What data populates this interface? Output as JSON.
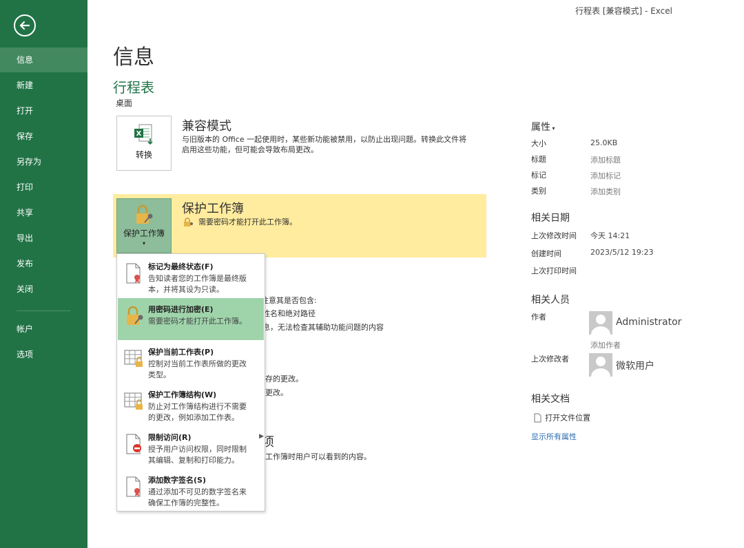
{
  "window_title": "行程表  [兼容模式] - Excel",
  "sidebar": {
    "items": [
      {
        "label": "信息",
        "active": true
      },
      {
        "label": "新建"
      },
      {
        "label": "打开"
      },
      {
        "label": "保存"
      },
      {
        "label": "另存为"
      },
      {
        "label": "打印"
      },
      {
        "label": "共享"
      },
      {
        "label": "导出"
      },
      {
        "label": "发布"
      },
      {
        "label": "关闭"
      },
      {
        "label": "帐户"
      },
      {
        "label": "选项"
      }
    ]
  },
  "main": {
    "page_title": "信息",
    "file_name": "行程表",
    "file_location": "桌面",
    "compat": {
      "button_label": "转换",
      "title": "兼容模式",
      "desc_line1": "与旧版本的 Office 一起使用时，某些新功能被禁用，以防止出现问题。转换此文件将",
      "desc_line2": "启用这些功能，但可能会导致布局更改。"
    },
    "protect": {
      "button_label": "保护工作簿",
      "title": "保护工作簿",
      "desc": "需要密码才能打开此工作簿。"
    },
    "background_lines": [
      "注意其是否包含:",
      "姓名和绝对路径",
      "息，无法检查其辅助功能问题的内容",
      "存的更改。",
      "更改。",
      "项",
      "工作簿时用户可以看到的内容。"
    ]
  },
  "dropdown": {
    "items": [
      {
        "title": "标记为最终状态(F)",
        "desc_line1": "告知读者您的工作簿是最终版",
        "desc_line2": "本，并将其设为只读。",
        "icon": "final-document-icon"
      },
      {
        "title": "用密码进行加密(E)",
        "desc_line1": "需要密码才能打开此工作簿。",
        "desc_line2": "",
        "icon": "lock-key-icon",
        "highlighted": true
      },
      {
        "title": "保护当前工作表(P)",
        "desc_line1": "控制对当前工作表所做的更改",
        "desc_line2": "类型。",
        "icon": "sheet-lock-icon"
      },
      {
        "title": "保护工作簿结构(W)",
        "desc_line1": "防止对工作簿结构进行不需要",
        "desc_line2": "的更改，例如添加工作表。",
        "icon": "workbook-structure-lock-icon"
      },
      {
        "title": "限制访问(R)",
        "desc_line1": "授予用户访问权限，同时限制",
        "desc_line2": "其编辑、复制和打印能力。",
        "icon": "restrict-access-icon"
      },
      {
        "title": "添加数字签名(S)",
        "desc_line1": "通过添加不可见的数字签名来",
        "desc_line2": "确保工作簿的完整性。",
        "icon": "digital-signature-icon"
      }
    ]
  },
  "properties": {
    "header": "属性",
    "rows": [
      {
        "label": "大小",
        "value": "25.0KB"
      },
      {
        "label": "标题",
        "value": "添加标题"
      },
      {
        "label": "标记",
        "value": "添加标记"
      },
      {
        "label": "类别",
        "value": "添加类别"
      }
    ],
    "dates_header": "相关日期",
    "dates": [
      {
        "label": "上次修改时间",
        "value": "今天 14:21"
      },
      {
        "label": "创建时间",
        "value": "2023/5/12 19:23"
      },
      {
        "label": "上次打印时间",
        "value": ""
      }
    ],
    "people_header": "相关人员",
    "author_label": "作者",
    "author_name": "Administrator",
    "add_author": "添加作者",
    "last_modified_by_label": "上次修改者",
    "last_modified_by": "微软用户",
    "docs_header": "相关文档",
    "open_location": "打开文件位置",
    "show_all": "显示所有属性"
  },
  "colors": {
    "sidebar": "#217346",
    "active_nav": "#43895f",
    "highlight": "#ffec9e",
    "menu_highlight": "#9fd4ab",
    "accent_link": "#2b6cb0"
  }
}
